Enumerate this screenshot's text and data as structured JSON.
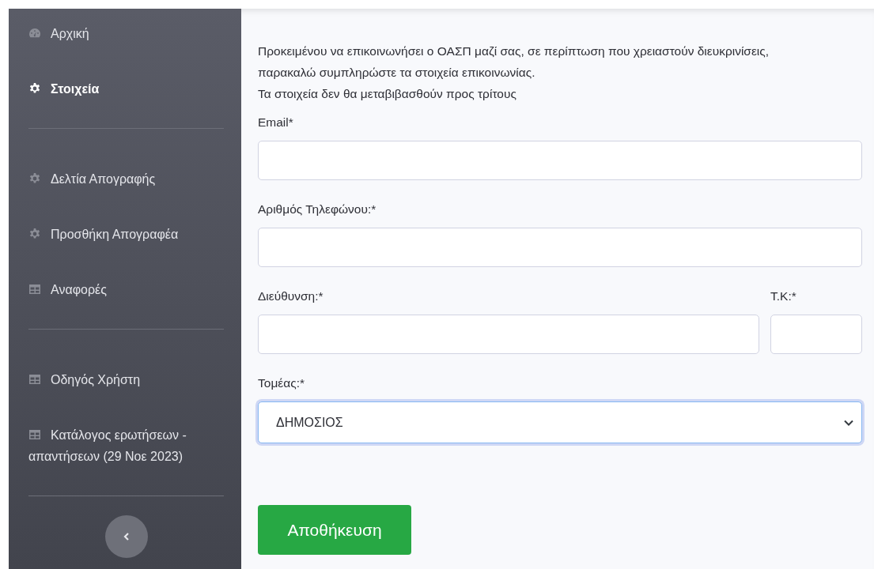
{
  "sidebar": {
    "items": [
      {
        "label": "Αρχική",
        "kind": "gauge",
        "selected": false,
        "divider_after": false
      },
      {
        "label": "Στοιχεία",
        "kind": "gear",
        "selected": true,
        "divider_after": true
      },
      {
        "label": "Δελτία Απογραφής",
        "kind": "gear",
        "selected": false,
        "divider_after": false
      },
      {
        "label": "Προσθήκη Απογραφέα",
        "kind": "gear",
        "selected": false,
        "divider_after": false
      },
      {
        "label": "Αναφορές",
        "kind": "table",
        "selected": false,
        "divider_after": true
      },
      {
        "label": "Οδηγός Χρήστη",
        "kind": "table",
        "selected": false,
        "divider_after": false
      },
      {
        "label": "Κατάλογος ερωτήσεων - απαντήσεων (29 Νοε 2023)",
        "kind": "table",
        "selected": false,
        "divider_after": true
      }
    ]
  },
  "intro": [
    "Προκειμένου να επικοινωνήσει ο ΟΑΣΠ μαζί σας, σε περίπτωση που χρειαστούν διευκρινίσεις, παρακαλώ συμπληρώστε τα στοιχεία επικοινωνίας.",
    "Τα στοιχεία δεν θα μεταβιβασθούν προς τρίτους"
  ],
  "form": {
    "email": {
      "label": "Email*"
    },
    "phone": {
      "label": "Αριθμός Τηλεφώνου:*"
    },
    "address": {
      "label": "Διεύθυνση:*"
    },
    "postcode": {
      "label": "Τ.Κ:*"
    },
    "sector": {
      "label": "Τομέας:*",
      "value": "ΔΗΜΟΣΙΟΣ",
      "focused": true
    }
  },
  "save_button": "Αποθήκευση"
}
